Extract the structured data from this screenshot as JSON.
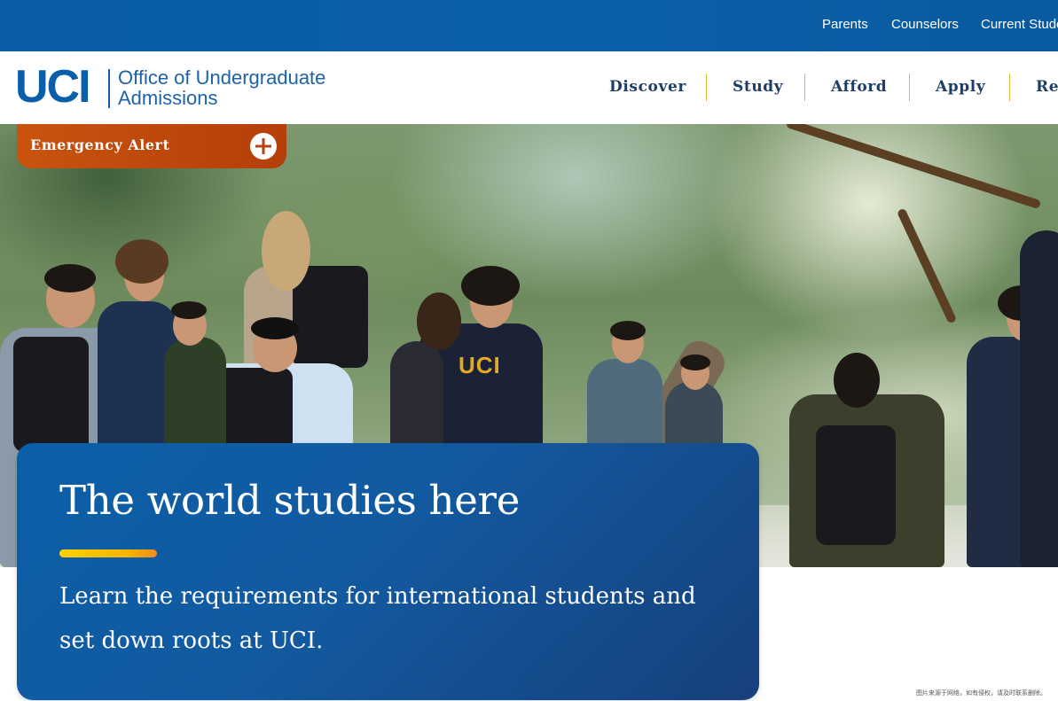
{
  "utility_nav": {
    "items": [
      {
        "label": "Parents"
      },
      {
        "label": "Counselors"
      },
      {
        "label": "Current Students"
      }
    ]
  },
  "header": {
    "logo_mark": "UCI",
    "logo_line1": "Office of Undergraduate",
    "logo_line2": "Admissions"
  },
  "main_nav": {
    "items": [
      {
        "label": "Discover"
      },
      {
        "label": "Study"
      },
      {
        "label": "Afford"
      },
      {
        "label": "Apply"
      },
      {
        "label": "Resources"
      }
    ]
  },
  "alert": {
    "label": "Emergency Alert",
    "icon": "plus-circle-icon"
  },
  "hero": {
    "title": "The world studies here",
    "subtitle": "Learn the requirements for international students and set down roots at UCI.",
    "shirt_text": "UCI"
  },
  "footer_note": {
    "text": "图片来源于网络，如有侵权，请及时联系删除。"
  },
  "colors": {
    "brand_blue": "#0b5ea8",
    "utility_bar": "#0a5da6",
    "nav_text": "#1d3e66",
    "nav_separator": "#e6b832",
    "alert_orange": "#c9530e",
    "accent_gold": "#ffd200"
  }
}
